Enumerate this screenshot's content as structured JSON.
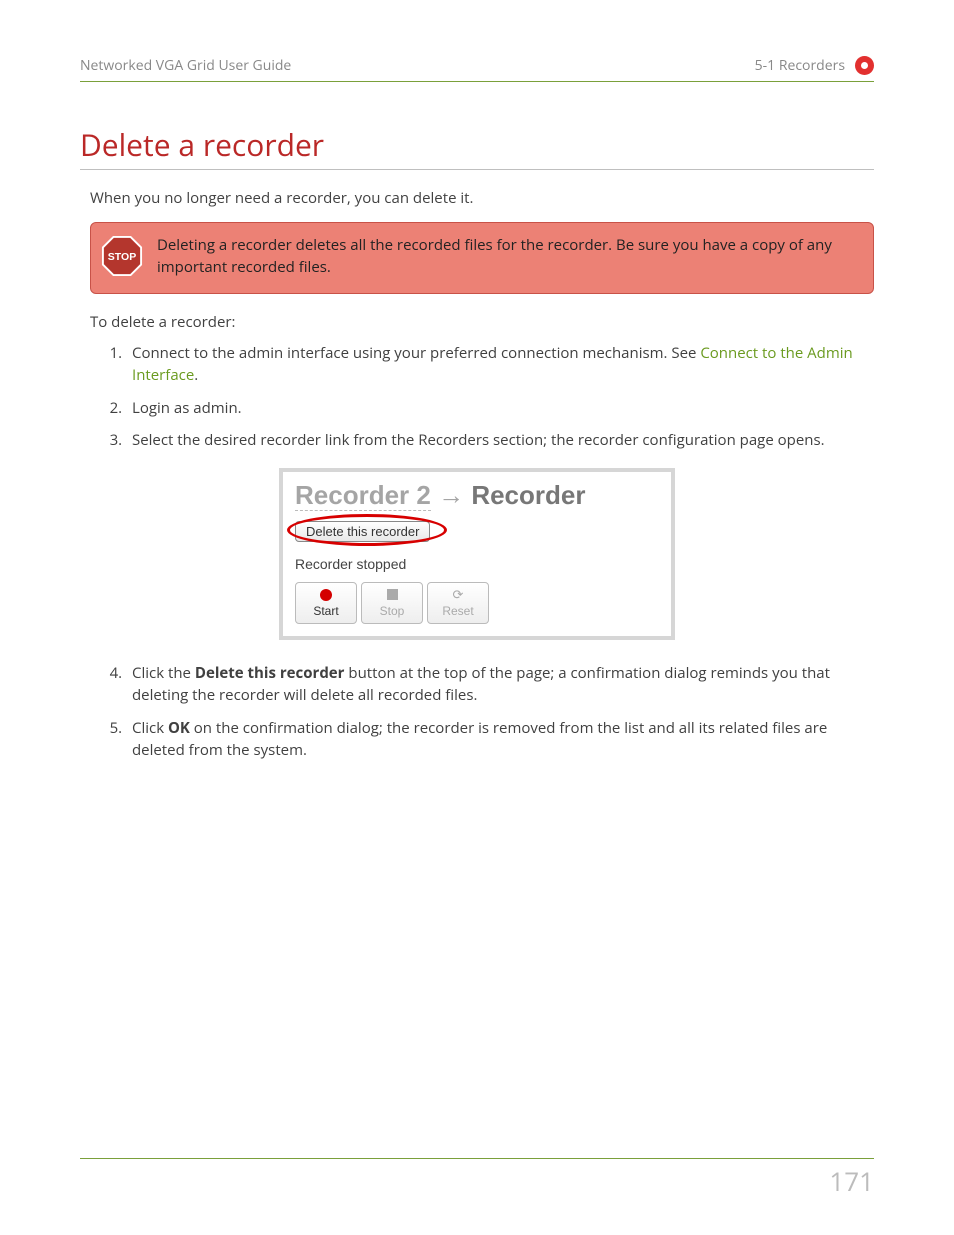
{
  "header": {
    "left": "Networked VGA Grid User Guide",
    "right": "5-1 Recorders"
  },
  "title": "Delete a recorder",
  "intro": "When you no longer need a recorder, you can delete it.",
  "warning": "Deleting a recorder deletes all the recorded files for the recorder. Be sure you have a copy of any important recorded files.",
  "lead2": "To delete a recorder:",
  "steps": {
    "s1_a": "Connect to the admin interface using your preferred connection mechanism. See ",
    "s1_link": "Connect to the Admin Interface",
    "s1_b": ".",
    "s2": "Login as admin.",
    "s3": "Select the desired recorder link from the Recorders section; the recorder configuration page opens.",
    "s4_a": "Click the ",
    "s4_bold": "Delete this recorder",
    "s4_b": " button at the top of the page; a confirmation dialog reminds you that deleting the recorder will delete all recorded files.",
    "s5_a": "Click ",
    "s5_bold": "OK",
    "s5_b": " on the confirmation dialog; the recorder is removed from the list and all its related files are deleted from the system."
  },
  "screenshot": {
    "crumb1": "Recorder 2",
    "arrow": "→",
    "crumb2": "Recorder",
    "delete_btn": "Delete this recorder",
    "status": "Recorder stopped",
    "btn_start": "Start",
    "btn_stop": "Stop",
    "btn_reset": "Reset"
  },
  "page_number": "171"
}
